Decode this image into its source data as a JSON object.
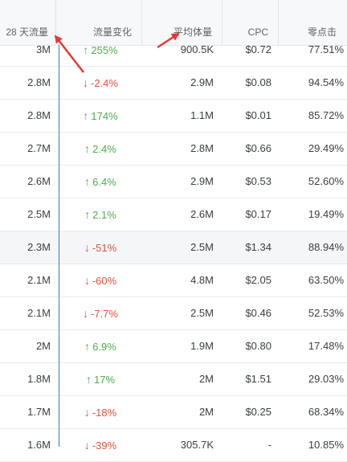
{
  "header": {
    "traffic_28d": "28 天流量",
    "traffic_change": "流量变化",
    "avg_volume": "平均体量",
    "cpc": "CPC",
    "zero_click": "零点击"
  },
  "rows": [
    {
      "traffic": "3M",
      "change": "255%",
      "dir": "up",
      "volume": "900.5K",
      "cpc": "$0.72",
      "zero": "77.51%"
    },
    {
      "traffic": "2.8M",
      "change": "-2.4%",
      "dir": "down",
      "volume": "2.9M",
      "cpc": "$0.08",
      "zero": "94.54%"
    },
    {
      "traffic": "2.8M",
      "change": "174%",
      "dir": "up",
      "volume": "1.1M",
      "cpc": "$0.01",
      "zero": "85.72%"
    },
    {
      "traffic": "2.7M",
      "change": "2.4%",
      "dir": "up",
      "volume": "2.8M",
      "cpc": "$0.66",
      "zero": "29.49%"
    },
    {
      "traffic": "2.6M",
      "change": "6.4%",
      "dir": "up",
      "volume": "2.9M",
      "cpc": "$0.53",
      "zero": "52.60%"
    },
    {
      "traffic": "2.5M",
      "change": "2.1%",
      "dir": "up",
      "volume": "2.6M",
      "cpc": "$0.17",
      "zero": "19.49%"
    },
    {
      "traffic": "2.3M",
      "change": "-51%",
      "dir": "down",
      "volume": "2.5M",
      "cpc": "$1.34",
      "zero": "88.94%"
    },
    {
      "traffic": "2.1M",
      "change": "-60%",
      "dir": "down",
      "volume": "4.8M",
      "cpc": "$2.05",
      "zero": "63.50%"
    },
    {
      "traffic": "2.1M",
      "change": "-7.7%",
      "dir": "down",
      "volume": "2.5M",
      "cpc": "$0.46",
      "zero": "52.53%"
    },
    {
      "traffic": "2M",
      "change": "6.9%",
      "dir": "up",
      "volume": "1.9M",
      "cpc": "$0.80",
      "zero": "17.48%"
    },
    {
      "traffic": "1.8M",
      "change": "17%",
      "dir": "up",
      "volume": "2M",
      "cpc": "$1.51",
      "zero": "29.03%"
    },
    {
      "traffic": "1.7M",
      "change": "-18%",
      "dir": "down",
      "volume": "2M",
      "cpc": "$0.25",
      "zero": "68.34%"
    },
    {
      "traffic": "1.6M",
      "change": "-39%",
      "dir": "down",
      "volume": "305.7K",
      "cpc": "-",
      "zero": "10.85%"
    }
  ],
  "highlighted_row": 6,
  "colors": {
    "up": "#4caf50",
    "down": "#e8503a",
    "annotation_arrow": "#e53935",
    "divider": "#3a7ca5"
  },
  "icons": {
    "up": "arrow-up-icon",
    "down": "arrow-down-icon"
  }
}
